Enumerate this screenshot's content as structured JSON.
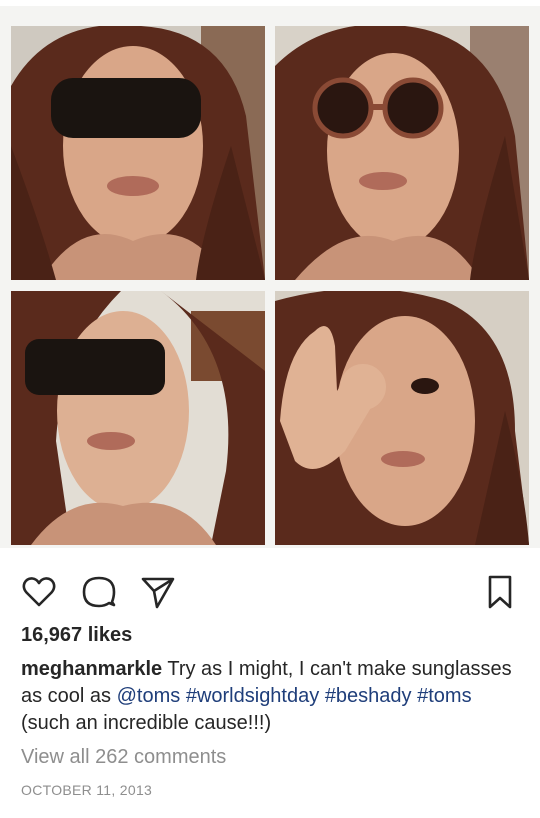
{
  "post": {
    "photo_count": 4,
    "likes_text": "16,967 likes",
    "username": "meghanmarkle",
    "caption_parts": [
      {
        "text": " Try as I might, I can't make sunglasses as cool as ",
        "type": "plain"
      },
      {
        "text": "@toms",
        "type": "mention"
      },
      {
        "text": " ",
        "type": "plain"
      },
      {
        "text": "#worldsightday",
        "type": "hashtag"
      },
      {
        "text": " ",
        "type": "plain"
      },
      {
        "text": "#beshady",
        "type": "hashtag"
      },
      {
        "text": " ",
        "type": "plain"
      },
      {
        "text": "#toms",
        "type": "hashtag"
      },
      {
        "text": " (such an incredible cause!!!)",
        "type": "plain"
      }
    ],
    "comments_link": "View all 262 comments",
    "date": "OCTOBER 11, 2013"
  },
  "icons": [
    "heart-icon",
    "comment-icon",
    "share-icon",
    "bookmark-icon"
  ],
  "colors": {
    "text": "#262626",
    "link": "#1f3e7a",
    "muted": "#8e8e8e",
    "hair": "#5a2a1c",
    "skin": "#d9a688"
  }
}
